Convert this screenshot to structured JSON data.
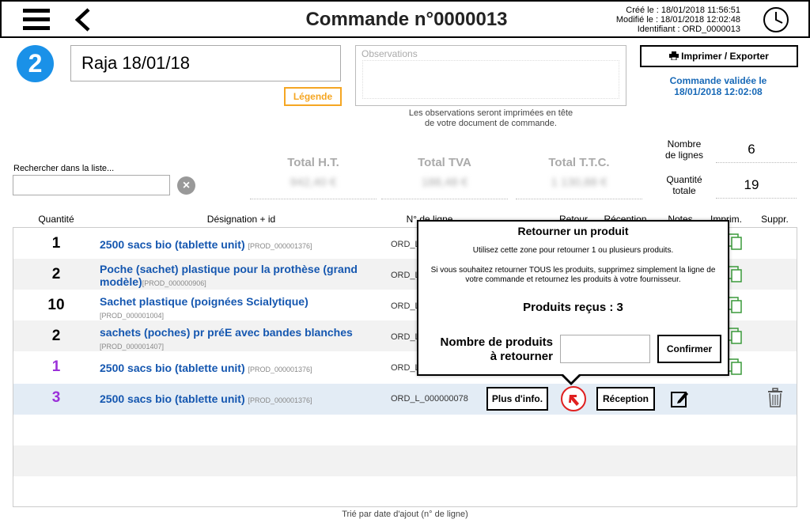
{
  "header": {
    "title": "Commande n°0000013",
    "created": "Créé le : 18/01/2018 11:56:51",
    "modified": "Modifié le : 18/01/2018 12:02:48",
    "identifier": "Identifiant : ORD_0000013"
  },
  "step": "2",
  "order_name": "Raja 18/01/18",
  "legend_label": "Légende",
  "observations": {
    "placeholder": "Observations",
    "note_line1": "Les observations seront imprimées en tête",
    "note_line2": "de votre document de commande."
  },
  "print_label": "Imprimer / Exporter",
  "validated_line1": "Commande validée le",
  "validated_line2": "18/01/2018 12:02:08",
  "search": {
    "label": "Rechercher dans la liste...",
    "value": ""
  },
  "totals": {
    "ht_label": "Total H.T.",
    "ht_value": "942,40 €",
    "tva_label": "Total TVA",
    "tva_value": "188,48 €",
    "ttc_label": "Total T.T.C.",
    "ttc_value": "1 130,88 €"
  },
  "stats": {
    "lines_label1": "Nombre",
    "lines_label2": "de lignes",
    "lines_value": "6",
    "qty_label1": "Quantité",
    "qty_label2": "totale",
    "qty_value": "19"
  },
  "columns": {
    "qty": "Quantité",
    "designation": "Désignation + id",
    "line": "N° de ligne",
    "return": "Retour",
    "reception": "Réception",
    "notes": "Notes",
    "print": "Imprim.",
    "delete": "Suppr."
  },
  "rows": [
    {
      "qty": "1",
      "name": "2500 sacs bio (tablette unit)",
      "name2": "",
      "id": "[PROD_000001376]",
      "line": "ORD_L_",
      "qty_color": "#000"
    },
    {
      "qty": "2",
      "name": "Poche (sachet) plastique pour la prothèse (grand",
      "name2": "modèle)",
      "id": "[PROD_000000906]",
      "line": "ORD_L_",
      "qty_color": "#000"
    },
    {
      "qty": "10",
      "name": "Sachet plastique (poignées Scialytique)",
      "name2": "",
      "id": "[PROD_000001004]",
      "line": "ORD_L_",
      "qty_color": "#000"
    },
    {
      "qty": "2",
      "name": "sachets (poches) pr préE avec bandes blanches",
      "name2": "",
      "id": "[PROD_000001407]",
      "line": "ORD_L_",
      "qty_color": "#000"
    },
    {
      "qty": "1",
      "name": "2500 sacs bio (tablette unit)",
      "name2": "",
      "id": "[PROD_000001376]",
      "line": "ORD_L_",
      "qty_color": "#9b30d9"
    },
    {
      "qty": "3",
      "name": "2500 sacs bio (tablette unit)",
      "name2": "",
      "id": "[PROD_000001376]",
      "line": "ORD_L_000000078",
      "qty_color": "#9b30d9"
    }
  ],
  "row_buttons": {
    "info": "Plus d'info.",
    "reception": "Réception"
  },
  "sort_note": "Trié par date d'ajout (n° de ligne)",
  "popup": {
    "title": "Retourner un produit",
    "text1": "Utilisez cette zone pour retourner 1 ou plusieurs produits.",
    "text2": "Si vous souhaitez retourner TOUS les produits, supprimez simplement la ligne de votre commande et retournez les produits à votre fournisseur.",
    "received": "Produits reçus : 3",
    "label1": "Nombre de produits",
    "label2": "à retourner",
    "input_value": "",
    "confirm": "Confirmer"
  },
  "colors": {
    "accent": "#1a91e8",
    "link": "#1557b0",
    "legend": "#f5a623",
    "purple_qty": "#9b30d9",
    "return_red": "#e02020"
  },
  "icons": [
    "menu-icon",
    "back-icon",
    "clock-icon",
    "printer-icon",
    "clear-icon",
    "return-icon",
    "edit-note-icon",
    "trash-icon",
    "print-copy-icon"
  ]
}
